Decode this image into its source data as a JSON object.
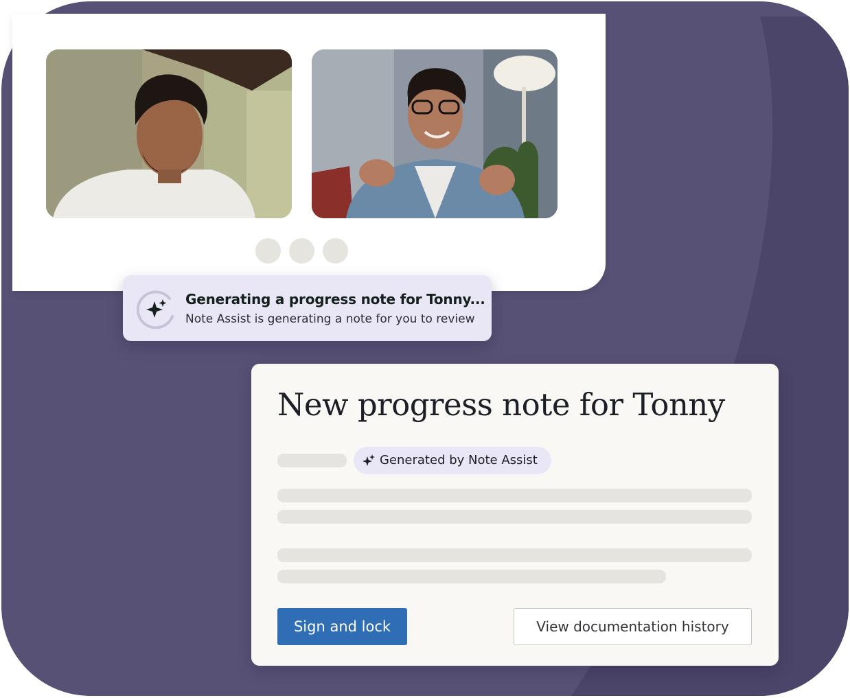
{
  "toast": {
    "title": "Generating a progress note for Tonny...",
    "subtitle": "Note Assist is generating a note for you to review"
  },
  "note": {
    "title": "New progress note for Tonny",
    "badge_label": "Generated by Note Assist",
    "primary_button": "Sign and lock",
    "secondary_button": "View documentation history"
  },
  "colors": {
    "background": "#575275",
    "toast_bg": "#e9e7f6",
    "primary_button": "#2f6db5",
    "card_bg": "#f9f8f5"
  },
  "icons": {
    "toast": "loading-sparkle-icon",
    "badge": "sparkle-icon"
  }
}
